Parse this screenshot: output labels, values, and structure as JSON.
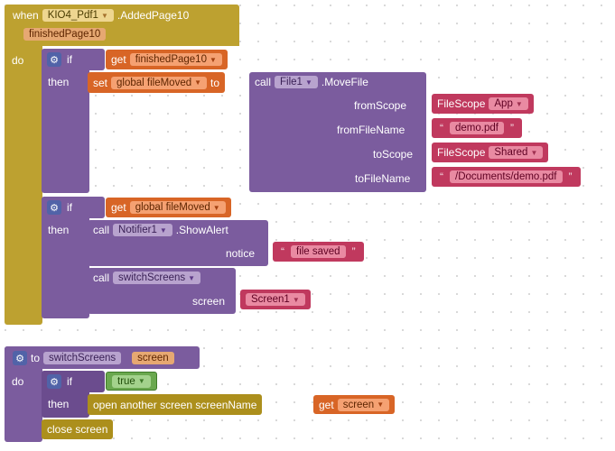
{
  "handler": {
    "when": "when",
    "component": "KIO4_Pdf1",
    "event": ".AddedPage10",
    "param": "finishedPage10",
    "do": "do"
  },
  "if1": {
    "gear": "⚙",
    "if": "if",
    "then": "then",
    "get": "get",
    "getVar": "finishedPage10",
    "set": "set",
    "setVar": "global fileMoved",
    "to": "to",
    "call": "call",
    "callComp": "File1",
    "callMethod": ".MoveFile",
    "fromScope": "fromScope",
    "fromScopeVal1": "FileScope",
    "fromScopeVal2": "App",
    "fromFileName": "fromFileName",
    "fromFileNameVal": "demo.pdf",
    "toScope": "toScope",
    "toScopeVal1": "FileScope",
    "toScopeVal2": "Shared",
    "toFileName": "toFileName",
    "toFileNameVal": "/Documents/demo.pdf"
  },
  "if2": {
    "if": "if",
    "then": "then",
    "get": "get",
    "getVar": "global fileMoved",
    "call1": "call",
    "call1Comp": "Notifier1",
    "call1Method": ".ShowAlert",
    "notice": "notice",
    "noticeVal": "file saved",
    "call2": "call",
    "call2Comp": "switchScreens",
    "screen": "screen",
    "screenVal": "Screen1"
  },
  "proc": {
    "to": "to",
    "name": "switchScreens",
    "param": "screen",
    "do": "do",
    "if": "if",
    "then": "then",
    "true": "true",
    "open": "open another screen  screenName",
    "get": "get",
    "getVar": "screen",
    "close": "close screen"
  }
}
